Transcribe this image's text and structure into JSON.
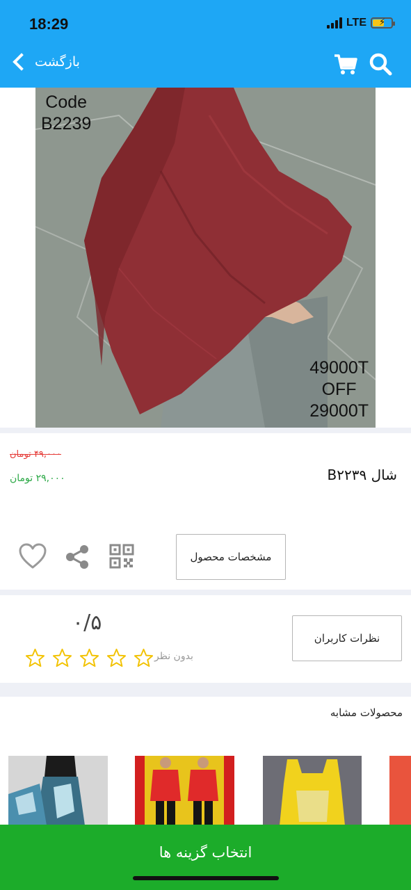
{
  "status_bar": {
    "time": "18:29",
    "network": "LTE"
  },
  "header": {
    "back_label": "بازگشت",
    "search_icon": "search-icon",
    "cart_icon": "cart-icon"
  },
  "product": {
    "image_code_line1": "Code",
    "image_code_line2": "B2239",
    "image_price_line1": "49000T",
    "image_price_line2": "OFF",
    "image_price_line3": "29000T",
    "old_price": "۴۹,۰۰۰ تومان",
    "new_price": "۲۹,۰۰۰ تومان",
    "name": "شال B۲۲۳۹"
  },
  "actions": {
    "spec_label": "مشخصات محصول",
    "icons": [
      "heart-icon",
      "share-icon",
      "qr-code-icon"
    ]
  },
  "rating": {
    "score": "۰/۵",
    "no_reviews": "بدون نظر",
    "stars_filled": 0,
    "stars_total": 5,
    "reviews_label": "نظرات کاربران"
  },
  "similar": {
    "title": "محصولات مشابه"
  },
  "bottom": {
    "cta_label": "انتخاب گزینه ها"
  },
  "colors": {
    "header": "#1ea7f5",
    "cta": "#1cac2a",
    "old_price": "#e53935",
    "new_price": "#2aa845",
    "star": "#f2c200"
  }
}
